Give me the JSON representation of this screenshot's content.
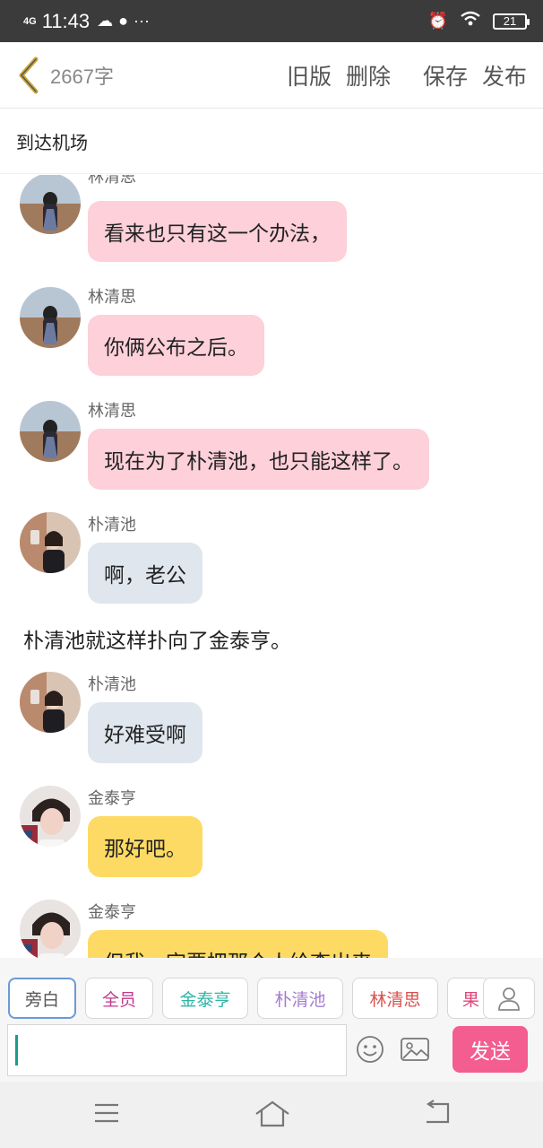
{
  "status_bar": {
    "network": "4G",
    "time": "11:43",
    "battery": "21"
  },
  "header": {
    "word_count": "2667字",
    "actions": {
      "old_version": "旧版",
      "delete": "删除",
      "save": "保存",
      "publish": "发布"
    }
  },
  "chapter_title": "到达机场",
  "messages": [
    {
      "type": "dialog",
      "sender": "林清思",
      "text": "看来也只有这一个办法，",
      "avatar": "linqingsi-avatar"
    },
    {
      "type": "dialog",
      "sender": "林清思",
      "text": "你俩公布之后。",
      "avatar": "linqingsi-avatar"
    },
    {
      "type": "dialog",
      "sender": "林清思",
      "text": "现在为了朴清池，也只能这样了。",
      "avatar": "linqingsi-avatar"
    },
    {
      "type": "dialog",
      "sender": "朴清池",
      "text": "啊，老公",
      "avatar": "puqingchi-avatar"
    },
    {
      "type": "narration",
      "text": "朴清池就这样扑向了金泰亨。"
    },
    {
      "type": "dialog",
      "sender": "朴清池",
      "text": "好难受啊",
      "avatar": "puqingchi-avatar"
    },
    {
      "type": "dialog",
      "sender": "金泰亨",
      "text": "那好吧。",
      "avatar": "jintaiheng-avatar"
    },
    {
      "type": "dialog",
      "sender": "金泰亨",
      "text": "但我一定要把那个人给查出来",
      "avatar": "jintaiheng-avatar"
    }
  ],
  "roles": [
    {
      "label": "旁白",
      "color": "#555555"
    },
    {
      "label": "全员",
      "color": "#c2388a"
    },
    {
      "label": "金泰亨",
      "color": "#2fb5a6"
    },
    {
      "label": "朴清池",
      "color": "#a57cd0"
    },
    {
      "label": "林清思",
      "color": "#d8504c"
    },
    {
      "label": "果",
      "color": "#e0457a"
    }
  ],
  "input": {
    "value": "",
    "send_label": "发送"
  },
  "colors": {
    "pink_bubble": "#fdd0da",
    "gray_bubble": "#dfe6ee",
    "yellow_bubble": "#fdda63",
    "send_button": "#f45d8f",
    "back_chevron": "#c9a53a"
  },
  "icons": [
    "back-chevron-icon",
    "emoji-icon",
    "image-icon",
    "person-icon",
    "menu-icon",
    "home-icon",
    "return-icon"
  ]
}
